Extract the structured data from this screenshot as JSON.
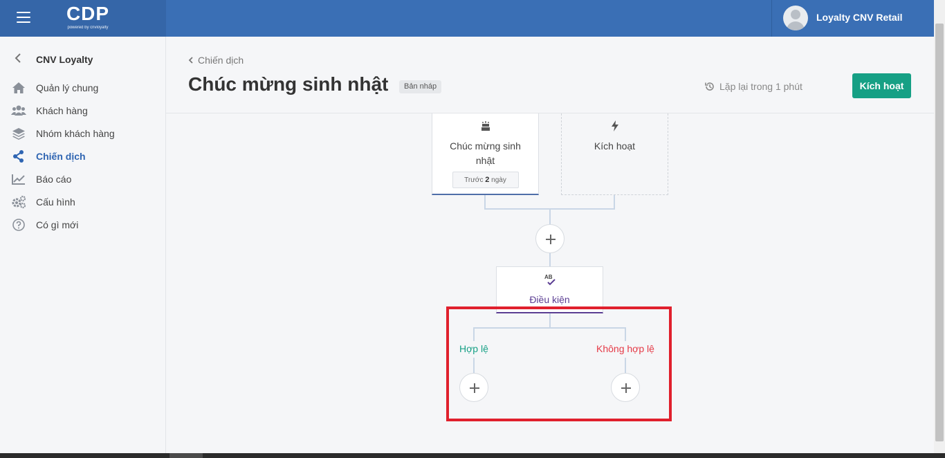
{
  "topbar": {
    "menu_icon": "hamburger-menu-icon",
    "logo_text": "CDP",
    "logo_subtext": "powered by cnvloyalty",
    "user_name": "Loyalty CNV Retail",
    "primary_color": "#3a6fb5"
  },
  "sidebar": {
    "title": "CNV Loyalty",
    "items": [
      {
        "label": "Quản lý chung",
        "icon": "home-icon"
      },
      {
        "label": "Khách hàng",
        "icon": "users-icon"
      },
      {
        "label": "Nhóm khách hàng",
        "icon": "layers-icon"
      },
      {
        "label": "Chiến dịch",
        "icon": "share-icon",
        "active": true
      },
      {
        "label": "Báo cáo",
        "icon": "chart-line-icon"
      },
      {
        "label": "Cấu hình",
        "icon": "gears-icon"
      },
      {
        "label": "Có gì mới",
        "icon": "question-circle-icon"
      }
    ],
    "active_color": "#2f65b2"
  },
  "header": {
    "breadcrumb": "Chiến dịch",
    "title": "Chúc mừng sinh nhật",
    "status_badge": "Bản nháp",
    "repeat_text": "Lặp lại trong 1 phút",
    "activate_button": "Kích hoạt",
    "button_color": "#16a085"
  },
  "flow": {
    "trigger_node": {
      "label": "Chúc mừng sinh nhật",
      "icon": "birthday-cake-icon",
      "time_prefix": "Trước",
      "time_value": "2",
      "time_unit": "ngày"
    },
    "activate_node": {
      "label": "Kích hoạt",
      "icon": "bolt-icon"
    },
    "condition_node": {
      "label": "Điều kiện",
      "icon": "spell-check-icon"
    },
    "branches": {
      "valid": "Hợp lệ",
      "invalid": "Không hợp lệ",
      "valid_color": "#16a085",
      "invalid_color": "#e53946"
    },
    "highlight_color": "#e0202d"
  }
}
